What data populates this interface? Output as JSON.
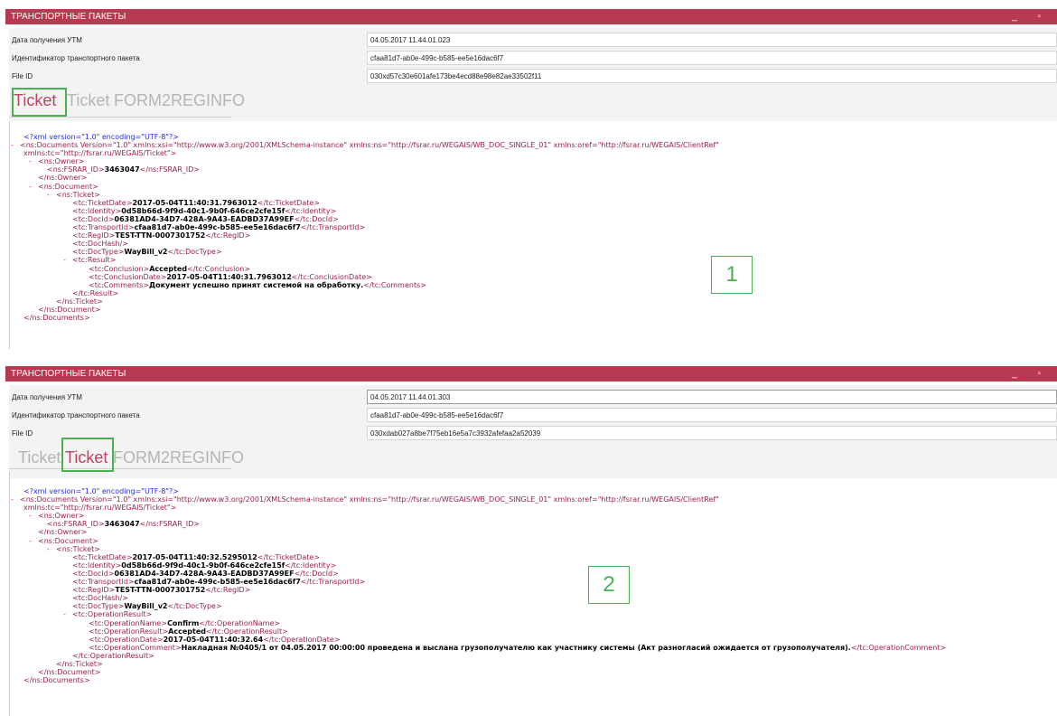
{
  "panel1": {
    "title": "ТРАНСПОРТНЫЕ ПАКЕТЫ",
    "window_controls": "_ ▫",
    "fields": [
      {
        "label": "Дата получения УТМ",
        "value": "04.05.2017 11.44.01.023"
      },
      {
        "label": "Идентификатор транспортного пакета",
        "value": "cfaa81d7-ab0e-499c-b585-ee5e16dac6f7"
      },
      {
        "label": "File ID",
        "value": "030xd57c30e601afe173be4ecd88e98e82ae33502f11"
      }
    ],
    "tabs": [
      "Ticket",
      "Ticket",
      "FORM2REGINFO"
    ],
    "active_tab": 0,
    "annotation": "1",
    "xml": {
      "decl": "<?xml version=\"1.0\" encoding=\"UTF-8\"?>",
      "root_open": "<ns:Documents Version=\"1.0\" xmlns:xsi=\"http://www.w3.org/2001/XMLSchema-instance\" xmlns:ns=\"http://fsrar.ru/WEGAIS/WB_DOC_SINGLE_01\" xmlns:oref=\"http://fsrar.ru/WEGAIS/ClientRef\"",
      "root_open_cont": "xmlns:tc=\"http://fsrar.ru/WEGAIS/Ticket\">",
      "fsrar_id": "3463047",
      "ticket_date": "2017-05-04T11:40:31.7963012",
      "identity": "0d58b66d-9f9d-40c1-9b0f-646ce2cfe15f",
      "doc_id": "06381AD4-34D7-428A-9A43-EADBD37A99EF",
      "transport_id": "cfaa81d7-ab0e-499c-b585-ee5e16dac6f7",
      "reg_id": "TEST-TTN-0007301752",
      "doc_type": "WayBill_v2",
      "conclusion": "Accepted",
      "conclusion_date": "2017-05-04T11:40:31.7963012",
      "comments": "Документ успешно принят системой на обработку."
    }
  },
  "panel2": {
    "title": "ТРАНСПОРТНЫЕ ПАКЕТЫ",
    "window_controls": "_ ▫",
    "fields": [
      {
        "label": "Дата получения УТМ",
        "value": "04.05.2017 11.44.01.303"
      },
      {
        "label": "Идентификатор транспортного пакета",
        "value": "cfaa81d7-ab0e-499c-b585-ee5e16dac6f7"
      },
      {
        "label": "File ID",
        "value": "030xdab027a8be7f75eb16e5a7c3932afefaa2a52039"
      }
    ],
    "tabs": [
      "Ticket",
      "Ticket",
      "FORM2REGINFO"
    ],
    "active_tab": 1,
    "annotation": "2",
    "xml": {
      "decl": "<?xml version=\"1.0\" encoding=\"UTF-8\"?>",
      "root_open": "<ns:Documents Version=\"1.0\" xmlns:xsi=\"http://www.w3.org/2001/XMLSchema-instance\" xmlns:ns=\"http://fsrar.ru/WEGAIS/WB_DOC_SINGLE_01\" xmlns:oref=\"http://fsrar.ru/WEGAIS/ClientRef\"",
      "root_open_cont": "xmlns:tc=\"http://fsrar.ru/WEGAIS/Ticket\">",
      "fsrar_id": "3463047",
      "ticket_date": "2017-05-04T11:40:32.5295012",
      "identity": "0d58b66d-9f9d-40c1-9b0f-646ce2cfe15f",
      "doc_id": "06381AD4-34D7-428A-9A43-EADBD37A99EF",
      "transport_id": "cfaa81d7-ab0e-499c-b585-ee5e16dac6f7",
      "reg_id": "TEST-TTN-0007301752",
      "doc_type": "WayBill_v2",
      "operation_name": "Confirm",
      "operation_result": "Accepted",
      "operation_date": "2017-05-04T11:40:32.64",
      "operation_comment": "Накладная №0405/1 от 04.05.2017 00:00:00 проведена и выслана грузополучателю как участнику системы (Акт разногласий ожидается от грузополучателя)."
    }
  }
}
